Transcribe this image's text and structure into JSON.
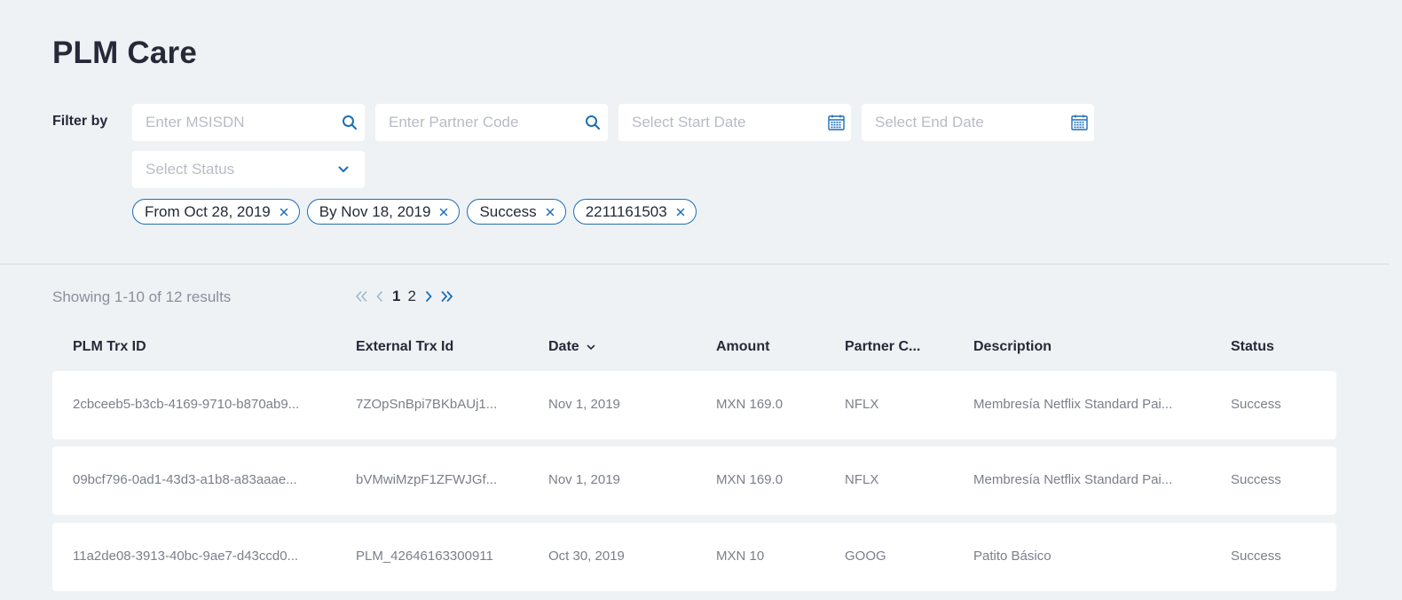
{
  "title": "PLM Care",
  "filters": {
    "label": "Filter by",
    "msisdn_placeholder": "Enter MSISDN",
    "partner_placeholder": "Enter Partner Code",
    "start_date_placeholder": "Select Start Date",
    "end_date_placeholder": "Select End Date",
    "status_placeholder": "Select Status"
  },
  "chips": [
    "From Oct 28, 2019",
    "By Nov 18, 2019",
    "Success",
    "2211161503"
  ],
  "results": {
    "showing": "Showing 1-10 of 12 results"
  },
  "pagination": {
    "pages": [
      "1",
      "2"
    ],
    "current": "1"
  },
  "table": {
    "headers": {
      "plm_trx_id": "PLM Trx ID",
      "external_trx_id": "External Trx Id",
      "date": "Date",
      "amount": "Amount",
      "partner_code": "Partner C...",
      "description": "Description",
      "status": "Status"
    },
    "rows": [
      {
        "plm_trx_id": "2cbceeb5-b3cb-4169-9710-b870ab9...",
        "external_trx_id": "7ZOpSnBpi7BKbAUj1...",
        "date": "Nov 1, 2019",
        "amount": "MXN 169.0",
        "partner_code": "NFLX",
        "description": "Membresía Netflix Standard Pai...",
        "status": "Success"
      },
      {
        "plm_trx_id": "09bcf796-0ad1-43d3-a1b8-a83aaae...",
        "external_trx_id": "bVMwiMzpF1ZFWJGf...",
        "date": "Nov 1, 2019",
        "amount": "MXN 169.0",
        "partner_code": "NFLX",
        "description": "Membresía Netflix Standard Pai...",
        "status": "Success"
      },
      {
        "plm_trx_id": "11a2de08-3913-40bc-9ae7-d43ccd0...",
        "external_trx_id": "PLM_42646163300911",
        "date": "Oct 30, 2019",
        "amount": "MXN 10",
        "partner_code": "GOOG",
        "description": "Patito Básico",
        "status": "Success"
      }
    ]
  },
  "colors": {
    "background": "#eff2f5",
    "accent": "#1d6fb8",
    "accent_disabled": "#9fb6cc",
    "title": "#262a38",
    "muted_text": "#7a7f8a",
    "placeholder": "#b7bcc5"
  },
  "icons": {
    "msisdn_search": "search-icon",
    "partner_search": "search-icon",
    "start_date": "calendar-icon",
    "end_date": "calendar-icon",
    "status_dropdown": "chevron-down-icon",
    "chip_remove": "close-icon",
    "pager_first": "double-chevron-left-icon",
    "pager_prev": "chevron-left-icon",
    "pager_next": "chevron-right-icon",
    "pager_last": "double-chevron-right-icon",
    "date_sort": "chevron-down-icon"
  }
}
